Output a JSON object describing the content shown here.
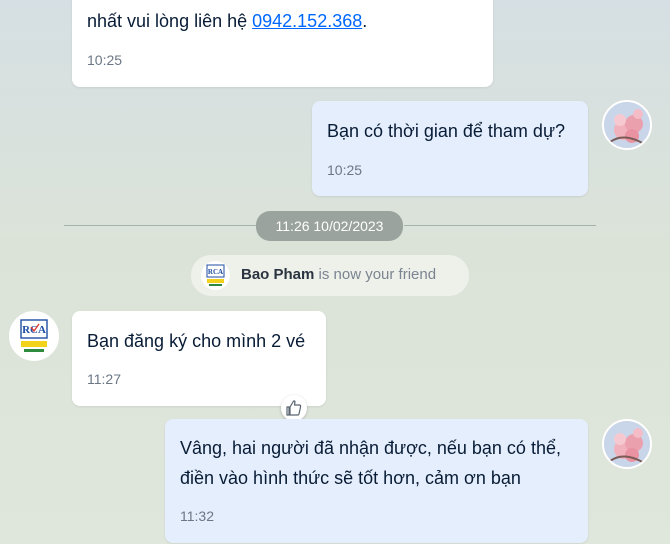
{
  "messages": [
    {
      "id": "m1",
      "line1": "nhất vui lòng liên hệ ",
      "phone": "0942.152.368",
      "after": ".",
      "time": "10:25"
    },
    {
      "id": "m2",
      "text": "Bạn có thời gian để tham dự?",
      "time": "10:25"
    },
    {
      "id": "m3",
      "text": "Bạn đăng ký cho mình 2 vé",
      "time": "11:27"
    },
    {
      "id": "m4",
      "line1": "Vâng, hai người đã nhận được, nếu bạn có thể,",
      "line2": "điền vào hình thức sẽ tốt hơn, cảm ơn bạn",
      "time": "11:32"
    }
  ],
  "divider": {
    "timestamp": "11:26 10/02/2023"
  },
  "friend_notice": {
    "name": "Bao Pham",
    "suffix": " is now your friend"
  },
  "colors": {
    "link": "#0068ff",
    "outgoing": "#e5eefc",
    "incoming": "#ffffff"
  }
}
